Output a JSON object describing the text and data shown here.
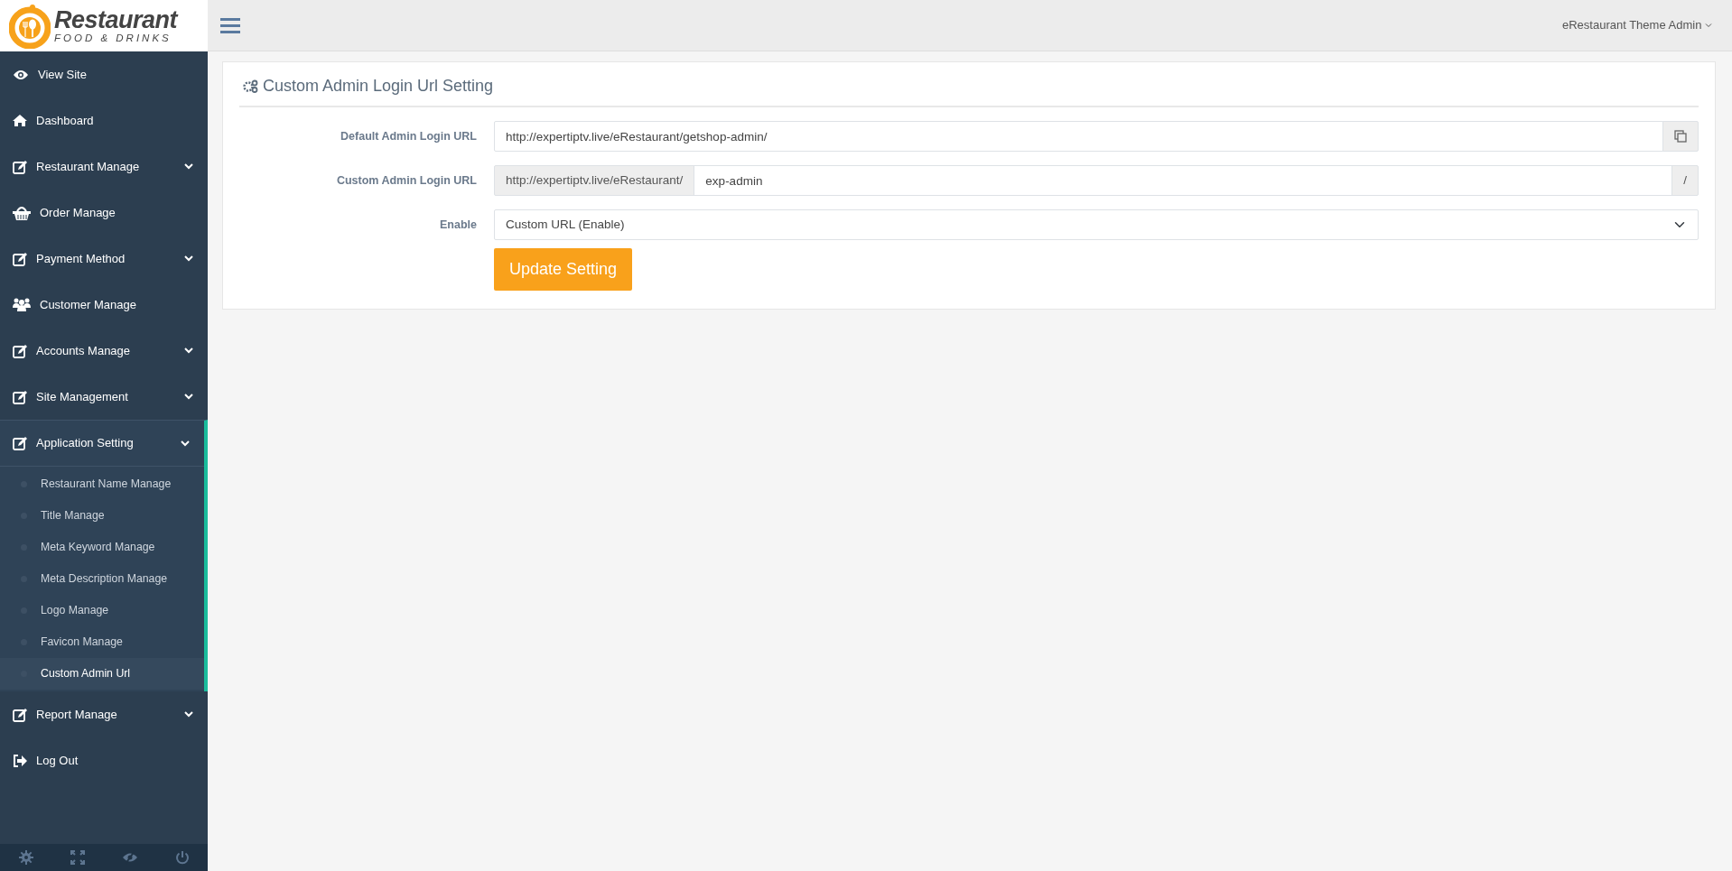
{
  "logo": {
    "title": "Restaurant",
    "subtitle": "FOOD & DRINKS"
  },
  "header": {
    "user": "eRestaurant Theme Admin"
  },
  "sidebar": {
    "items": [
      {
        "kind": "link",
        "label": "View Site"
      },
      {
        "kind": "link",
        "label": "Dashboard"
      },
      {
        "kind": "menu",
        "label": "Restaurant Manage",
        "expanded": false
      },
      {
        "kind": "link",
        "label": "Order Manage"
      },
      {
        "kind": "menu",
        "label": "Payment Method",
        "expanded": false
      },
      {
        "kind": "link",
        "label": "Customer Manage"
      },
      {
        "kind": "menu",
        "label": "Accounts Manage",
        "expanded": false
      },
      {
        "kind": "menu",
        "label": "Site Management",
        "expanded": false
      },
      {
        "kind": "menu",
        "label": "Application Setting",
        "expanded": true,
        "children": [
          {
            "label": "Restaurant Name Manage",
            "selected": false
          },
          {
            "label": "Title Manage",
            "selected": false
          },
          {
            "label": "Meta Keyword Manage",
            "selected": false
          },
          {
            "label": "Meta Description Manage",
            "selected": false
          },
          {
            "label": "Logo Manage",
            "selected": false
          },
          {
            "label": "Favicon Manage",
            "selected": false
          },
          {
            "label": "Custom Admin Url",
            "selected": true
          }
        ]
      },
      {
        "kind": "menu",
        "label": "Report Manage",
        "expanded": false
      },
      {
        "kind": "link",
        "label": "Log Out"
      }
    ]
  },
  "panel": {
    "title": "Custom Admin Login Url Setting",
    "fields": [
      {
        "kind": "copy",
        "label": "Default Admin Login URL",
        "value": "http://expertiptv.live/eRestaurant/getshop-admin/"
      },
      {
        "kind": "prefix",
        "label": "Custom Admin Login URL",
        "prefix": "http://expertiptv.live/eRestaurant/",
        "value": "exp-admin",
        "suffix": "/"
      },
      {
        "kind": "select",
        "label": "Enable",
        "value": "Custom URL (Enable)"
      }
    ],
    "button": "Update Setting"
  }
}
